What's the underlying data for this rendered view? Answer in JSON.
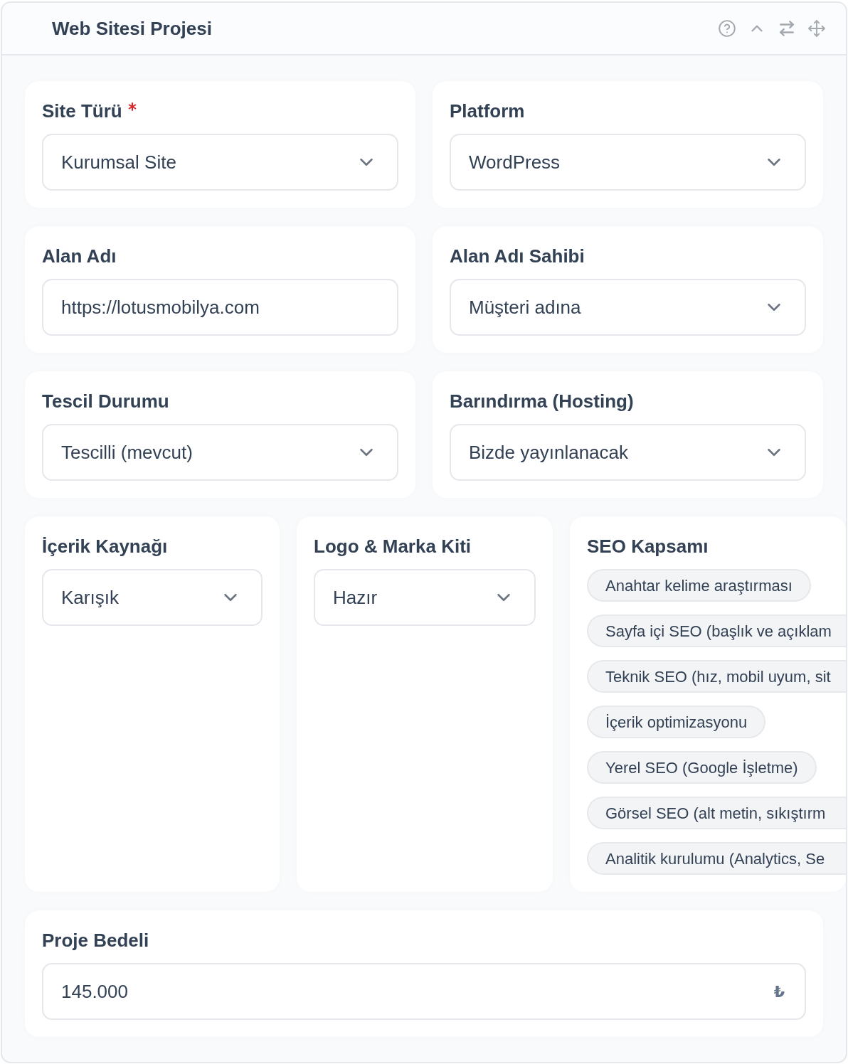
{
  "panel": {
    "title": "Web Sitesi Projesi"
  },
  "rows": [
    {
      "fields": [
        {
          "kind": "select",
          "label": "Site Türü",
          "required": true,
          "value": "Kurumsal Site"
        },
        {
          "kind": "select",
          "label": "Platform",
          "required": false,
          "value": "WordPress"
        }
      ]
    },
    {
      "fields": [
        {
          "kind": "text",
          "label": "Alan Adı",
          "required": false,
          "value": "https://lotusmobilya.com"
        },
        {
          "kind": "select",
          "label": "Alan Adı Sahibi",
          "required": false,
          "value": "Müşteri adına"
        }
      ]
    },
    {
      "fields": [
        {
          "kind": "select",
          "label": "Tescil Durumu",
          "required": false,
          "value": "Tescilli (mevcut)"
        },
        {
          "kind": "select",
          "label": "Barındırma (Hosting)",
          "required": false,
          "value": "Bizde yayınlanacak"
        }
      ]
    },
    {
      "fields": [
        {
          "kind": "select",
          "label": "İçerik Kaynağı",
          "required": false,
          "value": "Karışık"
        },
        {
          "kind": "select",
          "label": "Logo & Marka Kiti",
          "required": false,
          "value": "Hazır"
        },
        {
          "kind": "chips",
          "label": "SEO Kapsamı",
          "required": false,
          "chips": [
            {
              "label": "Anahtar kelime araştırması",
              "cut_off": false
            },
            {
              "label": "Sayfa içi SEO (başlık ve açıklam",
              "cut_off": true
            },
            {
              "label": "Teknik SEO (hız, mobil uyum, sit",
              "cut_off": true
            },
            {
              "label": "İçerik optimizasyonu",
              "cut_off": false
            },
            {
              "label": "Yerel SEO (Google İşletme)",
              "cut_off": false
            },
            {
              "label": "Görsel SEO (alt metin, sıkıştırm",
              "cut_off": true
            },
            {
              "label": "Analitik kurulumu (Analytics, Se",
              "cut_off": true
            }
          ]
        }
      ]
    },
    {
      "fields": [
        {
          "kind": "text",
          "label": "Proje Bedeli",
          "required": false,
          "value": "145.000",
          "suffix": "₺"
        }
      ]
    }
  ]
}
